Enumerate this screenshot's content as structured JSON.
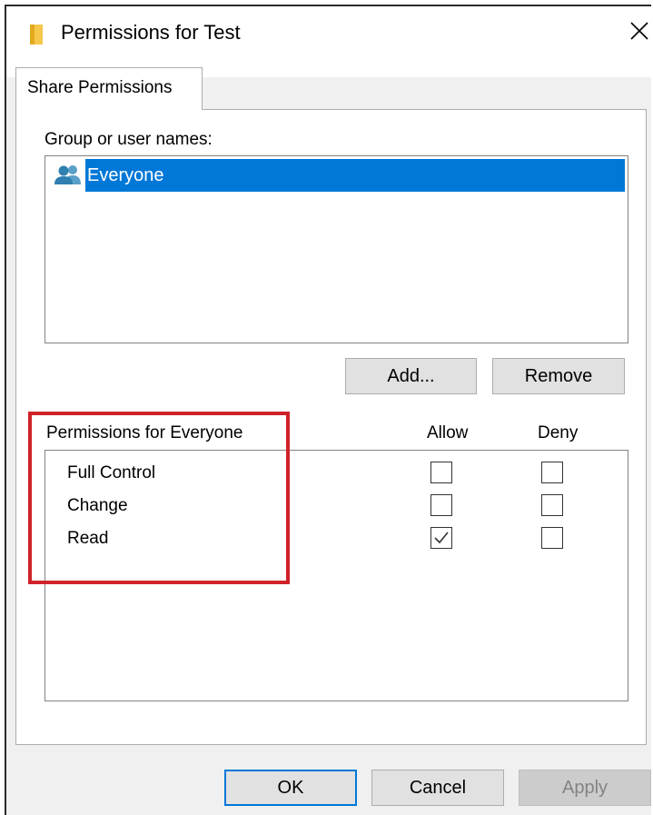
{
  "window": {
    "title": "Permissions for Test"
  },
  "tabs": [
    {
      "label": "Share Permissions",
      "active": true
    }
  ],
  "group_label": "Group or user names:",
  "users": [
    {
      "name": "Everyone",
      "selected": true
    }
  ],
  "buttons": {
    "add": "Add...",
    "remove": "Remove",
    "ok": "OK",
    "cancel": "Cancel",
    "apply": "Apply"
  },
  "permissions": {
    "header": "Permissions for Everyone",
    "columns": [
      "Allow",
      "Deny"
    ],
    "rows": [
      {
        "name": "Full Control",
        "allow": false,
        "deny": false
      },
      {
        "name": "Change",
        "allow": false,
        "deny": false
      },
      {
        "name": "Read",
        "allow": true,
        "deny": false
      }
    ]
  },
  "icons": {
    "folder": "folder-icon",
    "close": "close-icon",
    "users": "users-icon",
    "check": "check-icon"
  },
  "colors": {
    "selection": "#0078d7",
    "highlight_box": "#d0222a",
    "focus_border": "#0078d7"
  }
}
